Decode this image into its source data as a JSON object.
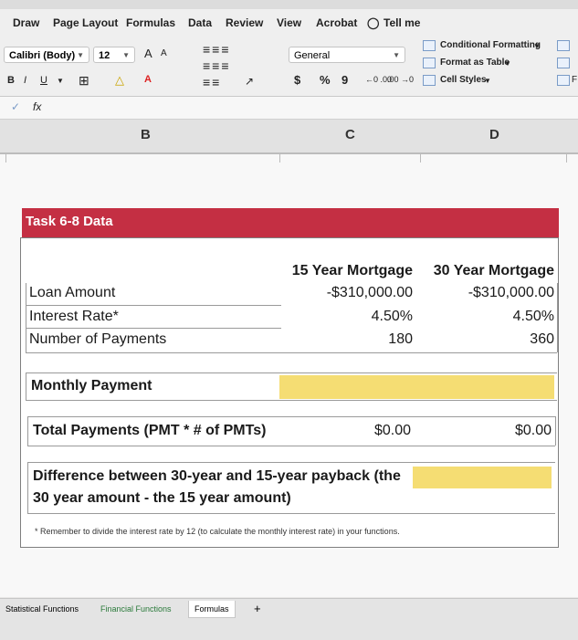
{
  "menu": [
    "Draw",
    "Page Layout",
    "Formulas",
    "Data",
    "Review",
    "View",
    "Acrobat",
    "Tell me"
  ],
  "toolbar": {
    "font_name": "Calibri (Body)",
    "font_size": "12",
    "grow_label": "A",
    "shrink_label": "A",
    "bold": "B",
    "italic": "I",
    "underline": "U",
    "fontcolor_label": "A",
    "number_format": "General",
    "currency": "$",
    "percent": "%",
    "comma": "9",
    "inc_decimal": "←0 .00",
    "dec_decimal": ".00 →0",
    "conditional_formatting": "Conditional Formatting",
    "format_as_table": "Format as Table",
    "cell_styles": "Cell Styles",
    "right_letter": "F"
  },
  "formula_bar": {
    "fx": "fx"
  },
  "columns": [
    "B",
    "C",
    "D"
  ],
  "sheet": {
    "section_title": "Task 6-8 Data",
    "col_headers": [
      "15 Year Mortgage",
      "30 Year Mortgage"
    ],
    "rows": [
      {
        "label": "Loan Amount",
        "v15": "-$310,000.00",
        "v30": "-$310,000.00"
      },
      {
        "label": "Interest Rate*",
        "v15": "4.50%",
        "v30": "4.50%"
      },
      {
        "label": "Number of Payments",
        "v15": "180",
        "v30": "360"
      }
    ],
    "monthly_payment_label": "Monthly Payment",
    "total_payments_label": "Total Payments (PMT * # of PMTs)",
    "total15": "$0.00",
    "total30": "$0.00",
    "difference_line1": "Difference between 30-year and 15-year payback (the",
    "difference_line2": "30 year amount - the 15 year amount)",
    "note": "* Remember to divide the interest rate by 12 (to calculate the monthly interest rate) in your functions."
  },
  "tabs": [
    "Statistical Functions",
    "Financial Functions",
    "Formulas",
    "+"
  ],
  "colors": {
    "title_bar": "#c42f43",
    "input_fill": "#f5dd73",
    "active_tab": "#ffffff"
  }
}
